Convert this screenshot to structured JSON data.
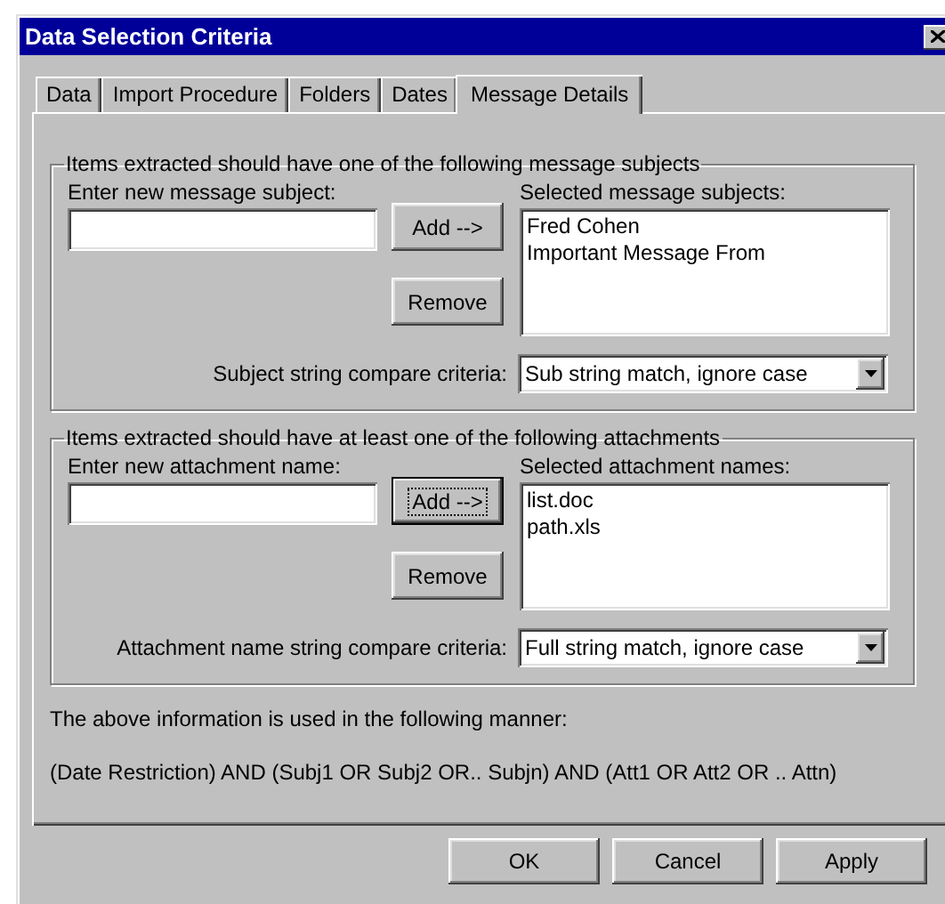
{
  "window": {
    "title": "Data Selection Criteria"
  },
  "tabs": [
    {
      "label": "Data",
      "selected": false
    },
    {
      "label": "Import Procedure",
      "selected": false
    },
    {
      "label": "Folders",
      "selected": false
    },
    {
      "label": "Dates",
      "selected": false
    },
    {
      "label": "Message Details",
      "selected": true
    }
  ],
  "groups": [
    {
      "title": "Items extracted should have one of the following message subjects",
      "input_label": "Enter new message subject:",
      "add_button": {
        "label": "Add -->",
        "focused": false
      },
      "remove_button": "Remove",
      "list_label": "Selected message subjects:",
      "list_items": [
        "Fred Cohen",
        "Important Message From"
      ],
      "criteria_label": "Subject string compare criteria:",
      "criteria_value": "Sub string match, ignore case"
    },
    {
      "title": "Items extracted should have at least one of the following attachments",
      "input_label": "Enter new attachment name:",
      "add_button": {
        "label": "Add -->",
        "focused": true
      },
      "remove_button": "Remove",
      "list_label": "Selected attachment names:",
      "list_items": [
        "list.doc",
        "path.xls"
      ],
      "criteria_label": "Attachment name string compare criteria:",
      "criteria_value": "Full string match, ignore case"
    }
  ],
  "info_text": "The above information is used in the following manner:",
  "formula_text": "(Date Restriction) AND (Subj1 OR Subj2 OR.. Subjn) AND (Att1 OR Att2 OR .. Attn)",
  "buttons": [
    "OK",
    "Cancel",
    "Apply"
  ]
}
